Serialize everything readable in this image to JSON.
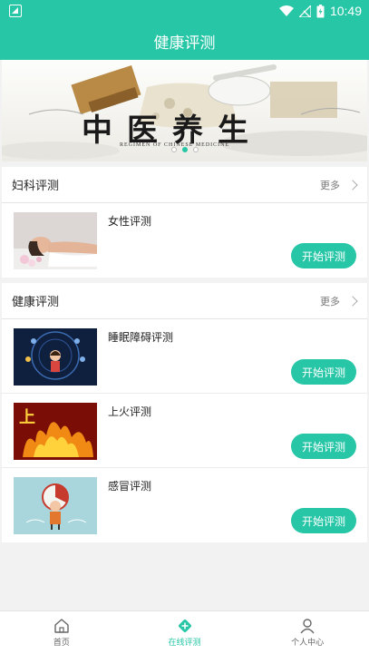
{
  "status_bar": {
    "time": "10:49"
  },
  "header": {
    "title": "健康评测"
  },
  "banner": {
    "calligraphy": "中医养生",
    "caption": "REGIMEN OF CHINESE MEDICINE",
    "slides": 3,
    "active_slide": 2
  },
  "sections": [
    {
      "title": "妇科评测",
      "more_label": "更多",
      "items": [
        {
          "title": "女性评测",
          "button": "开始评测",
          "thumb": "spa-woman"
        }
      ]
    },
    {
      "title": "健康评测",
      "more_label": "更多",
      "items": [
        {
          "title": "睡眠障碍评测",
          "button": "开始评测",
          "thumb": "sleep"
        },
        {
          "title": "上火评测",
          "button": "开始评测",
          "thumb": "fire"
        },
        {
          "title": "感冒评测",
          "button": "开始评测",
          "thumb": "cold"
        }
      ]
    }
  ],
  "tabs": [
    {
      "label": "首页",
      "icon": "home-icon",
      "active": false
    },
    {
      "label": "在线评测",
      "icon": "plus-diamond-icon",
      "active": true
    },
    {
      "label": "个人中心",
      "icon": "person-icon",
      "active": false
    }
  ],
  "colors": {
    "accent": "#26c6a6"
  }
}
